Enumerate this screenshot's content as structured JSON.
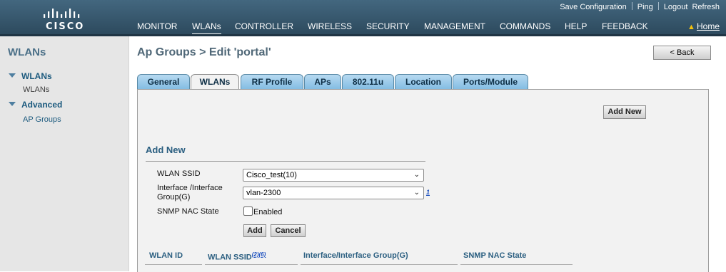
{
  "brand": {
    "logo_text": "CISCO"
  },
  "utility_links": [
    "Save Configuration",
    "Ping",
    "Logout",
    "Refresh"
  ],
  "menu": [
    "MONITOR",
    "WLANs",
    "CONTROLLER",
    "WIRELESS",
    "SECURITY",
    "MANAGEMENT",
    "COMMANDS",
    "HELP",
    "FEEDBACK"
  ],
  "menu_active": "WLANs",
  "home_label": "Home",
  "sidebar": {
    "title": "WLANs",
    "sections": [
      {
        "label": "WLANs",
        "items": [
          "WLANs"
        ]
      },
      {
        "label": "Advanced",
        "items": [
          "AP Groups"
        ]
      }
    ]
  },
  "page": {
    "title": "Ap Groups > Edit  'portal'",
    "back_label": "< Back"
  },
  "tabs": [
    "General",
    "WLANs",
    "RF Profile",
    "APs",
    "802.11u",
    "Location",
    "Ports/Module"
  ],
  "active_tab": "WLANs",
  "panel": {
    "add_new_button": "Add New",
    "section_title": "Add New",
    "wlan_ssid_label": "WLAN SSID",
    "wlan_ssid_value": "Cisco_test(10)",
    "interface_label_line1": "Interface /Interface",
    "interface_label_line2": "Group(G)",
    "interface_value": "vlan-2300",
    "interface_help": "1",
    "snmp_label": "SNMP NAC State",
    "snmp_checkbox_label": "Enabled",
    "snmp_checked": false,
    "add_button": "Add",
    "cancel_button": "Cancel"
  },
  "table": {
    "headers": [
      "WLAN ID",
      "WLAN SSID",
      "Interface/Interface Group(G)",
      "SNMP NAC State"
    ],
    "ssid_footnote": "(2)(6)"
  },
  "colors": {
    "header_bg": "#43677f",
    "tab_bg": "#9fcdec",
    "panel_bg": "#f2f2f2",
    "sidebar_bg": "#e6e6e6",
    "link_blue": "#1c5a7e"
  }
}
